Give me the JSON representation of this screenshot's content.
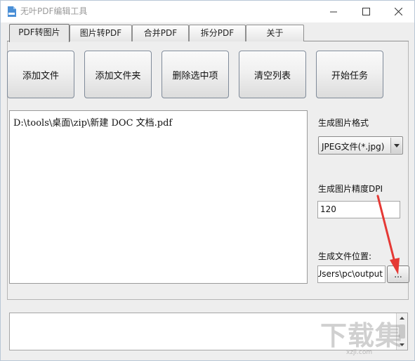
{
  "window": {
    "title": "无叶PDF编辑工具",
    "controls": {
      "minimize": "minimize-icon",
      "maximize": "maximize-icon",
      "close": "close-icon"
    }
  },
  "tabs": [
    {
      "label": "PDF转图片",
      "active": true
    },
    {
      "label": "图片转PDF",
      "active": false
    },
    {
      "label": "合并PDF",
      "active": false
    },
    {
      "label": "拆分PDF",
      "active": false
    },
    {
      "label": "关于",
      "active": false
    }
  ],
  "toolbar": {
    "add_file": "添加文件",
    "add_folder": "添加文件夹",
    "delete_selected": "删除选中项",
    "clear_list": "清空列表",
    "start_task": "开始任务"
  },
  "file_list": {
    "items": [
      "D:\\tools\\桌面\\zip\\新建 DOC 文档.pdf"
    ]
  },
  "settings": {
    "format_label": "生成图片格式",
    "format_value": "JPEG文件(*.jpg)",
    "dpi_label": "生成图片精度DPI",
    "dpi_value": "120",
    "output_label": "生成文件位置:",
    "output_value": "\\Users\\pc\\output",
    "browse_label": "..."
  },
  "watermark": {
    "text": "下载集",
    "sub": "xzji.com"
  },
  "colors": {
    "annotation_arrow": "#e53935",
    "title_text": "#9a9a9a"
  }
}
